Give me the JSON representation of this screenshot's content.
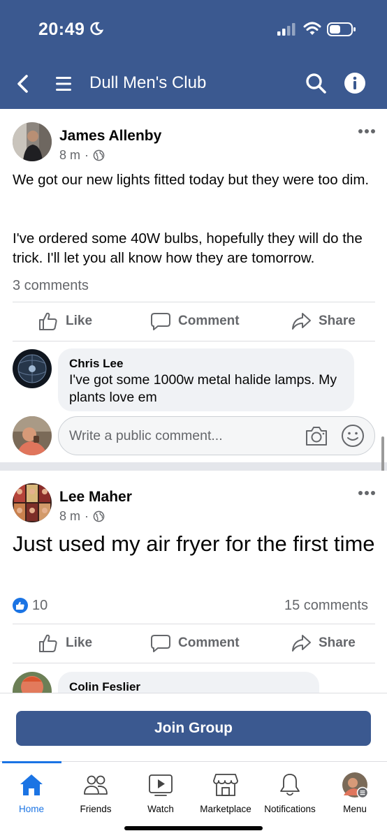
{
  "status_bar": {
    "time": "20:49"
  },
  "header": {
    "title": "Dull Men's Club"
  },
  "posts": [
    {
      "author": "James Allenby",
      "time": "8 m",
      "meta_sep": "·",
      "text_p1": "We got our new lights fitted today but they were too dim.",
      "text_p2": "I've ordered some 40W bulbs, hopefully they will do the trick. I'll let you all know how they are tomorrow.",
      "comments_count": "3 comments",
      "actions": {
        "like": "Like",
        "comment": "Comment",
        "share": "Share"
      },
      "top_comment": {
        "author": "Chris Lee",
        "text": "I've got some 1000w metal halide lamps. My plants love em"
      },
      "comment_input": {
        "placeholder": "Write a public comment..."
      }
    },
    {
      "author": "Lee Maher",
      "time": "8 m",
      "meta_sep": "·",
      "text": "Just used my air fryer for the first time",
      "like_count": "10",
      "comments_count": "15 comments",
      "actions": {
        "like": "Like",
        "comment": "Comment",
        "share": "Share"
      },
      "top_comment": {
        "author": "Colin Feslier"
      }
    }
  ],
  "join_button": "Join Group",
  "bottom_nav": {
    "items": [
      {
        "label": "Home",
        "icon": "home-icon",
        "active": true
      },
      {
        "label": "Friends",
        "icon": "friends-icon",
        "active": false
      },
      {
        "label": "Watch",
        "icon": "watch-icon",
        "active": false
      },
      {
        "label": "Marketplace",
        "icon": "marketplace-icon",
        "active": false
      },
      {
        "label": "Notifications",
        "icon": "bell-icon",
        "active": false
      },
      {
        "label": "Menu",
        "icon": "menu-avatar-icon",
        "active": false
      }
    ]
  },
  "colors": {
    "brand": "#3b5990",
    "accent": "#1b74e4",
    "secondary_text": "#65676b",
    "bubble": "#f0f2f5"
  }
}
